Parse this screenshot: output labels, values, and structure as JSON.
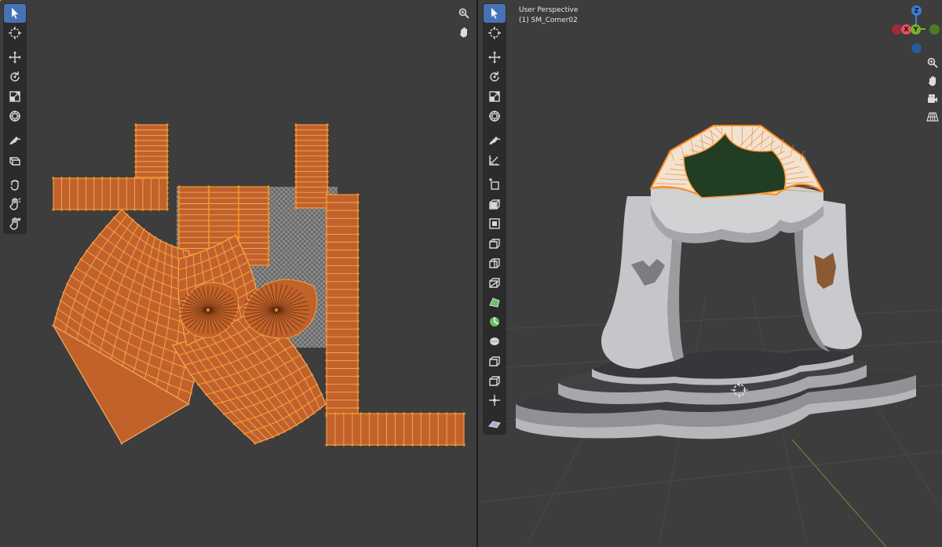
{
  "viewport": {
    "perspective_label": "User Perspective",
    "object_label": "(1) SM_Comer02"
  },
  "uv_toolbar": [
    {
      "name": "select-tool",
      "icon": "cursor-icon",
      "active": true
    },
    {
      "name": "cursor-tool",
      "icon": "crosshair-icon"
    },
    {
      "name": "move-tool",
      "icon": "move-icon"
    },
    {
      "name": "rotate-tool",
      "icon": "rotate-icon"
    },
    {
      "name": "scale-tool",
      "icon": "scale-icon"
    },
    {
      "name": "transform-tool",
      "icon": "transform-icon"
    },
    {
      "name": "annotate-tool",
      "icon": "annotate-icon"
    },
    {
      "name": "rip-tool",
      "icon": "rip-icon"
    },
    {
      "name": "grab-tool",
      "icon": "grab-icon"
    },
    {
      "name": "relax-tool",
      "icon": "relax-icon"
    },
    {
      "name": "pinch-tool",
      "icon": "pinch-icon"
    }
  ],
  "view3d_toolbar": [
    {
      "name": "select-tool",
      "icon": "cursor-icon",
      "active": true
    },
    {
      "name": "cursor-tool",
      "icon": "crosshair-icon"
    },
    {
      "name": "move-tool",
      "icon": "move-icon"
    },
    {
      "name": "rotate-tool",
      "icon": "rotate-icon"
    },
    {
      "name": "scale-tool",
      "icon": "scale-icon"
    },
    {
      "name": "transform-tool",
      "icon": "transform-icon"
    },
    {
      "name": "annotate-tool",
      "icon": "annotate-icon"
    },
    {
      "name": "measure-tool",
      "icon": "measure-icon"
    },
    {
      "name": "add-cube-tool",
      "icon": "add-cube-icon"
    },
    {
      "name": "extrude-tool",
      "icon": "extrude-icon"
    },
    {
      "name": "inset-tool",
      "icon": "inset-icon"
    },
    {
      "name": "bevel-tool",
      "icon": "bevel-icon"
    },
    {
      "name": "loop-cut-tool",
      "icon": "loop-cut-icon"
    },
    {
      "name": "knife-tool",
      "icon": "knife-icon"
    },
    {
      "name": "poly-build-tool",
      "icon": "poly-build-icon"
    },
    {
      "name": "spin-tool",
      "icon": "spin-icon"
    },
    {
      "name": "smooth-tool",
      "icon": "smooth-icon"
    },
    {
      "name": "edge-slide-tool",
      "icon": "edge-slide-icon"
    },
    {
      "name": "shrink-tool",
      "icon": "shrink-icon"
    },
    {
      "name": "shear-tool",
      "icon": "shear-icon"
    },
    {
      "name": "rip-region-tool",
      "icon": "rip-region-icon"
    }
  ],
  "gizmo": {
    "x_label": "X",
    "y_label": "Y",
    "z_label": "Z",
    "x_color": "#e84d5f",
    "y_color": "#73b32b",
    "z_color": "#3a7fd6"
  },
  "colors": {
    "uv_face": "#c2622a",
    "uv_edge": "#f0a040",
    "uv_vertex": "#ff8c1a",
    "accent": "#4772b3",
    "mesh_grey": "#c4c6c9",
    "dark_green": "#213d24"
  }
}
